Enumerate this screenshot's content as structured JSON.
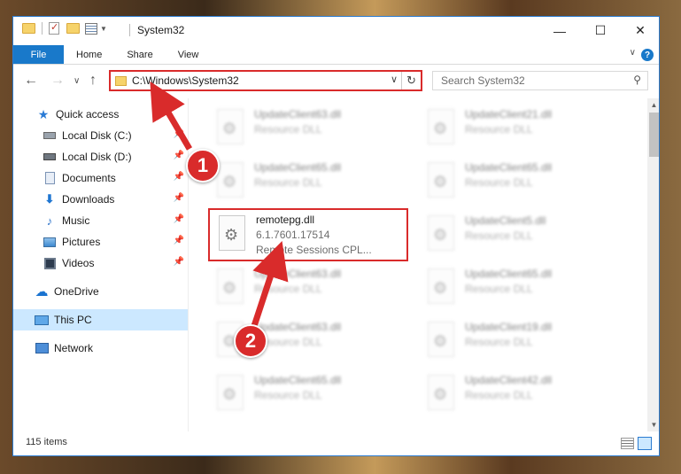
{
  "window": {
    "title": "System32",
    "controls": {
      "minimize": "—",
      "maximize": "☐",
      "close": "✕"
    }
  },
  "ribbon": {
    "tabs": [
      "File",
      "Home",
      "Share",
      "View"
    ],
    "help": "?",
    "expand": "∨"
  },
  "nav": {
    "back": "←",
    "forward": "→",
    "recent": "∨",
    "up": "↑",
    "address": "C:\\Windows\\System32",
    "address_dropdown": "∨",
    "refresh": "↻",
    "search_placeholder": "Search System32",
    "search_icon": "search-icon"
  },
  "sidebar": {
    "items": [
      {
        "label": "Quick access",
        "icon": "star-icon",
        "pinned": false
      },
      {
        "label": "Local Disk (C:)",
        "icon": "drive-icon",
        "pinned": true
      },
      {
        "label": "Local Disk (D:)",
        "icon": "drive-icon",
        "pinned": true
      },
      {
        "label": "Documents",
        "icon": "documents-icon",
        "pinned": true
      },
      {
        "label": "Downloads",
        "icon": "downloads-icon",
        "pinned": true
      },
      {
        "label": "Music",
        "icon": "music-icon",
        "pinned": true
      },
      {
        "label": "Pictures",
        "icon": "pictures-icon",
        "pinned": true
      },
      {
        "label": "Videos",
        "icon": "videos-icon",
        "pinned": true
      },
      {
        "label": "OneDrive",
        "icon": "cloud-icon",
        "pinned": false
      },
      {
        "label": "This PC",
        "icon": "computer-icon",
        "pinned": false,
        "selected": true
      },
      {
        "label": "Network",
        "icon": "network-icon",
        "pinned": false
      }
    ]
  },
  "files": {
    "left": [
      {
        "name": "UpdateClient63.dll",
        "sub": "Resource DLL",
        "blurred": true
      },
      {
        "name": "UpdateClient65.dll",
        "sub": "Resource DLL",
        "blurred": true
      },
      {
        "name": "remotepg.dll",
        "sub": "6.1.7601.17514",
        "sub2": "Remote Sessions CPL...",
        "blurred": false,
        "highlighted": true
      },
      {
        "name": "UpdateClient63.dll",
        "sub": "Resource DLL",
        "blurred": true
      },
      {
        "name": "UpdateClient63.dll",
        "sub": "Resource DLL",
        "blurred": true
      },
      {
        "name": "UpdateClient65.dll",
        "sub": "Resource DLL",
        "blurred": true
      }
    ],
    "right": [
      {
        "name": "UpdateClient21.dll",
        "sub": "Resource DLL",
        "blurred": true
      },
      {
        "name": "UpdateClient65.dll",
        "sub": "Resource DLL",
        "blurred": true
      },
      {
        "name": "UpdateClient5.dll",
        "sub": "Resource DLL",
        "blurred": true
      },
      {
        "name": "UpdateClient65.dll",
        "sub": "Resource DLL",
        "blurred": true
      },
      {
        "name": "UpdateClient19.dll",
        "sub": "Resource DLL",
        "blurred": true
      },
      {
        "name": "UpdateClient42.dll",
        "sub": "Resource DLL",
        "blurred": true
      }
    ]
  },
  "status": {
    "item_count": "115 items"
  },
  "annotations": {
    "step1": "1",
    "step2": "2",
    "color": "#d92b2b"
  }
}
